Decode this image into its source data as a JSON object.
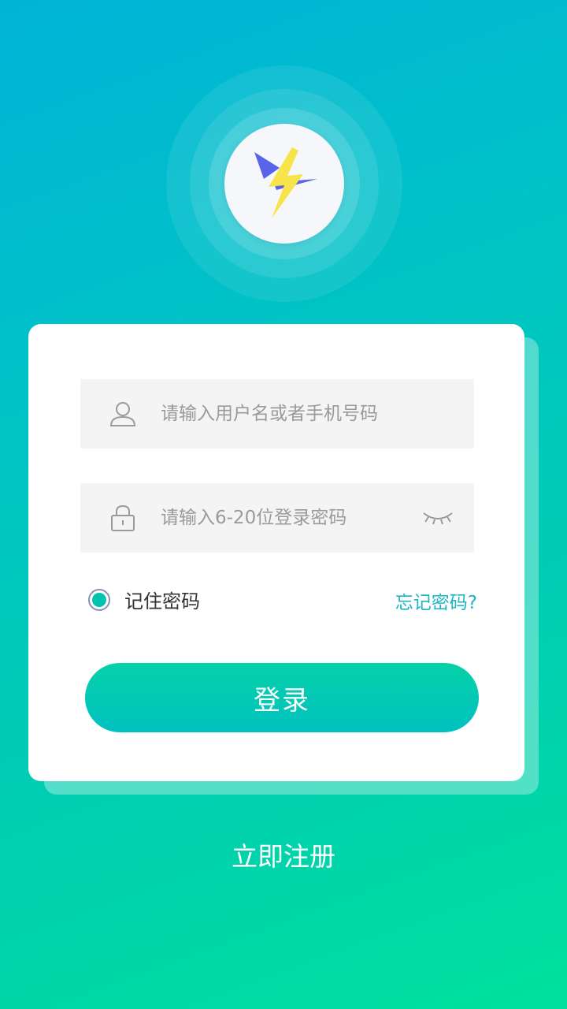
{
  "logo": {
    "icon": "lightning-logo-icon",
    "bolt_color": "#f7e34a",
    "accent_color": "#5865e8"
  },
  "form": {
    "username": {
      "icon": "user-icon",
      "placeholder": "请输入用户名或者手机号码",
      "value": ""
    },
    "password": {
      "icon": "lock-icon",
      "placeholder": "请输入6-20位登录密码",
      "value": "",
      "toggle_icon": "eye-closed-icon"
    },
    "remember": {
      "label": "记住密码",
      "checked": true
    },
    "forgot_label": "忘记密码?",
    "login_label": "登录"
  },
  "register_label": "立即注册",
  "colors": {
    "accent": "#00c3b0",
    "link": "#1cb6c2"
  }
}
